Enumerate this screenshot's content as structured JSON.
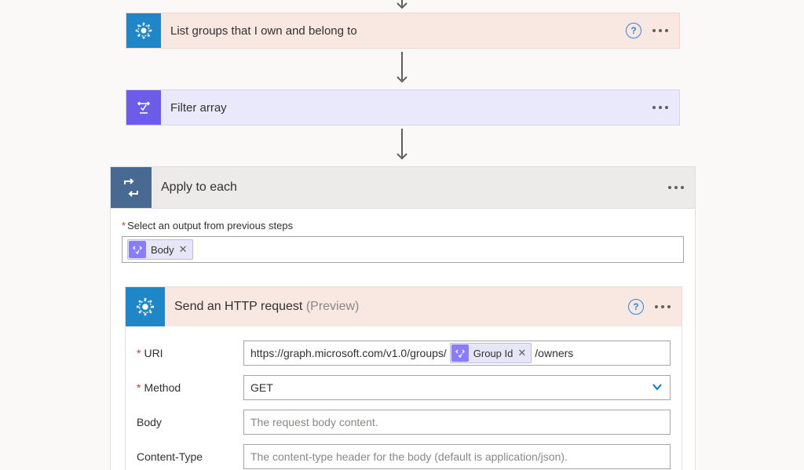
{
  "arrows": {},
  "cards": {
    "listGroups": {
      "title": "List groups that I own and belong to"
    },
    "filterArray": {
      "title": "Filter array"
    },
    "applyToEach": {
      "title": "Apply to each",
      "selectOutputLabel": "Select an output from previous steps",
      "outputToken": {
        "name": "Body"
      }
    },
    "sendHttp": {
      "title": "Send an HTTP request",
      "previewTag": "(Preview)",
      "fields": {
        "uri": {
          "label": "URI",
          "prefix": "https://graph.microsoft.com/v1.0/groups/",
          "token": {
            "name": "Group Id"
          },
          "suffix": "/owners"
        },
        "method": {
          "label": "Method",
          "value": "GET"
        },
        "body": {
          "label": "Body",
          "placeholder": "The request body content."
        },
        "contentType": {
          "label": "Content-Type",
          "placeholder": "The content-type header for the body (default is application/json)."
        }
      }
    }
  }
}
